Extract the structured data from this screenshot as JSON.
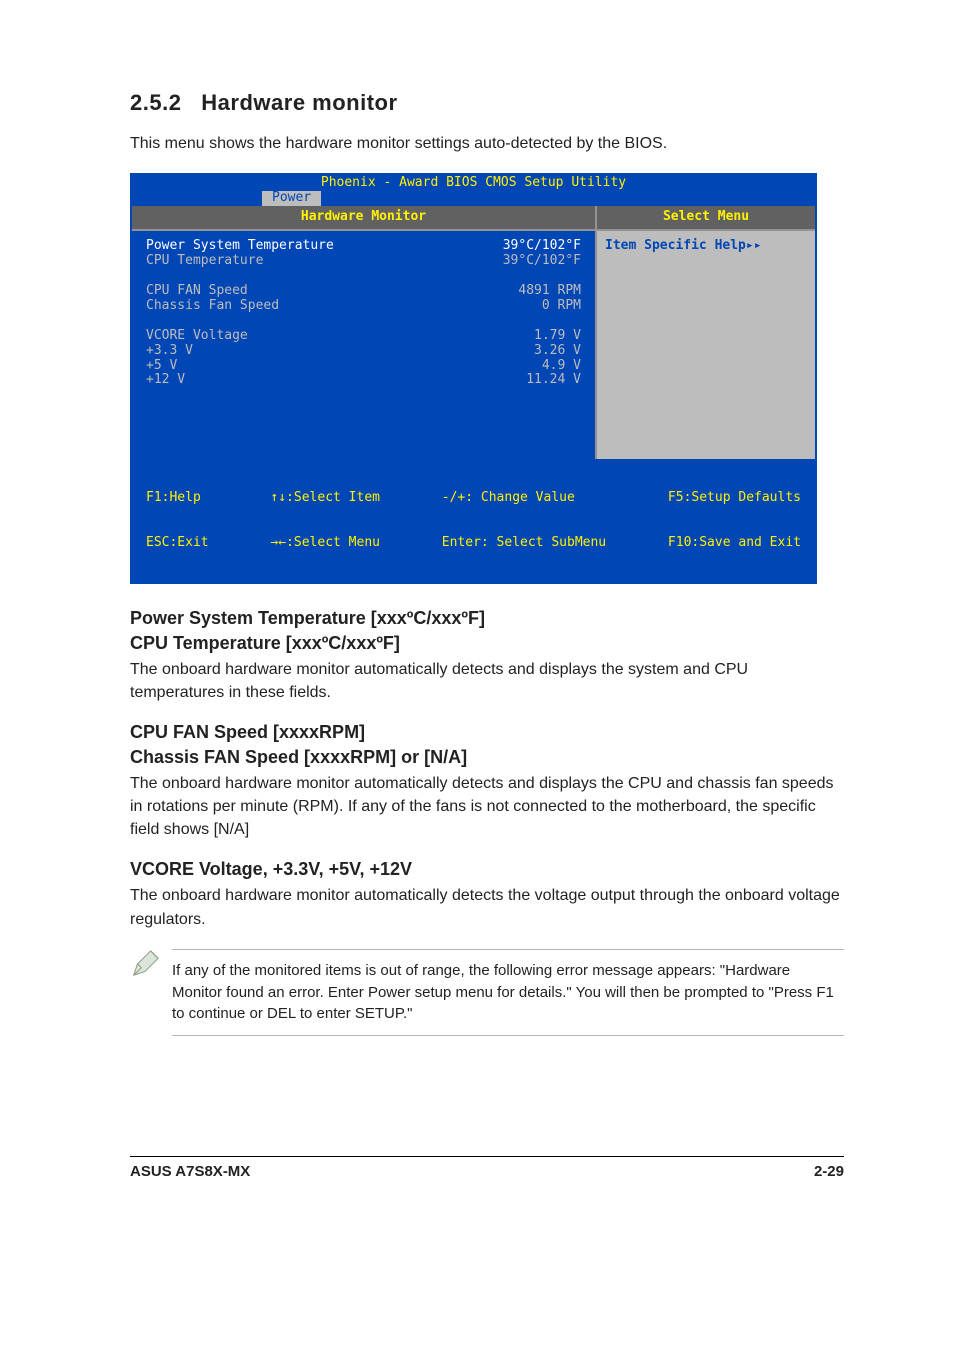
{
  "section": {
    "number": "2.5.2",
    "title": "Hardware monitor",
    "intro": "This menu shows the hardware monitor settings auto-detected by the BIOS."
  },
  "bios": {
    "utility_title": "Phoenix - Award BIOS CMOS Setup Utility",
    "tab": "Power",
    "left_header": "Hardware Monitor",
    "right_header": "Select Menu",
    "rows": [
      {
        "label": "Power System Temperature",
        "value": "39°C/102°F",
        "highlight": true
      },
      {
        "label": "CPU Temperature",
        "value": "39°C/102°F",
        "highlight": false
      },
      {
        "label": "",
        "value": ""
      },
      {
        "label": "CPU FAN Speed",
        "value": "4891 RPM",
        "highlight": false
      },
      {
        "label": "Chassis Fan Speed",
        "value": "0 RPM",
        "highlight": false
      },
      {
        "label": "",
        "value": ""
      },
      {
        "label": "VCORE Voltage",
        "value": "1.79 V",
        "highlight": false
      },
      {
        "label": "+3.3 V",
        "value": "3.26 V",
        "highlight": false
      },
      {
        "label": " +5  V",
        "value": "4.9 V",
        "highlight": false
      },
      {
        "label": "+12  V",
        "value": "11.24 V",
        "highlight": false
      }
    ],
    "help_text": "Item Specific Help",
    "legend": {
      "c1a": "F1:Help",
      "c1b": "ESC:Exit",
      "c2a": "↑↓:Select Item",
      "c2b": "→←:Select Menu",
      "c3a": "-/+: Change Value",
      "c3b": "Enter: Select SubMenu",
      "c4a": "F5:Setup Defaults",
      "c4b": "F10:Save and Exit"
    }
  },
  "subsections": {
    "s1_h1": "Power System Temperature [xxxºC/xxxºF]",
    "s1_h2": "CPU Temperature [xxxºC/xxxºF]",
    "s1_body": "The onboard hardware monitor automatically detects and displays the system and CPU temperatures in these fields.",
    "s2_h1": "CPU FAN Speed [xxxxRPM]",
    "s2_h2": "Chassis FAN Speed [xxxxRPM] or [N/A]",
    "s2_body": "The onboard hardware monitor automatically detects and displays the CPU and chassis fan speeds in rotations per minute (RPM). If any of the fans is not connected to the motherboard, the specific field shows [N/A]",
    "s3_h1": "VCORE Voltage, +3.3V, +5V, +12V",
    "s3_body": "The onboard hardware monitor automatically detects the voltage output through the onboard voltage regulators."
  },
  "note": "If any of the monitored items is out of range, the following error message appears: \"Hardware Monitor found an error. Enter Power setup menu for details.\" You will then be prompted to \"Press F1 to continue or DEL to enter SETUP.\"",
  "footer": {
    "left": "ASUS A7S8X-MX",
    "right": "2-29"
  }
}
